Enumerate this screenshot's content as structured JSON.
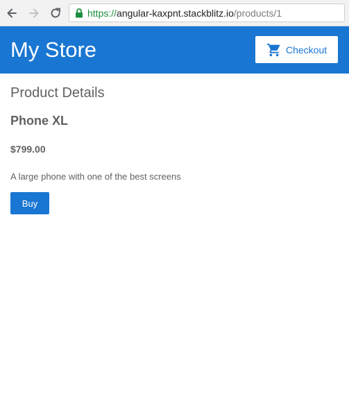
{
  "browser": {
    "url_scheme": "https://",
    "url_host": "angular-kaxpnt.stackblitz.io",
    "url_path": "/products/1"
  },
  "header": {
    "title": "My Store",
    "checkout_label": "Checkout"
  },
  "product": {
    "section_title": "Product Details",
    "name": "Phone XL",
    "price": "$799.00",
    "description": "A large phone with one of the best screens",
    "buy_label": "Buy"
  },
  "icons": {
    "back": "back-arrow-icon",
    "forward": "forward-arrow-icon",
    "reload": "reload-icon",
    "lock": "lock-icon",
    "cart": "shopping-cart-icon"
  },
  "colors": {
    "primary": "#1976d2",
    "secure": "#1e8e3e",
    "text": "#616161"
  }
}
